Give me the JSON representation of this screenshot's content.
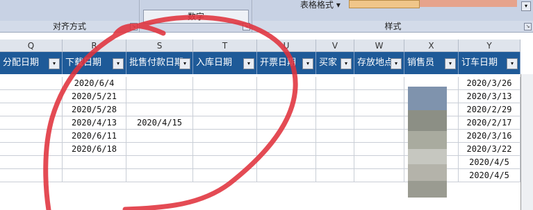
{
  "ribbon": {
    "align_label": "对齐方式",
    "number_label": "数字",
    "number_format": "数字",
    "style_label": "样式",
    "table_format_label": "表格格式 ▾",
    "launcher_glyph": "↘",
    "scroll_glyph": "▾"
  },
  "columns": [
    "Q",
    "R",
    "S",
    "T",
    "U",
    "V",
    "W",
    "X",
    "Y"
  ],
  "headers": [
    "分配日期",
    "下载日期",
    "批售付款日期",
    "入库日期",
    "开票日期",
    "买家",
    "存放地点",
    "销售员",
    "订车日期"
  ],
  "filter_glyphs": [
    "▾",
    "▾",
    "▾",
    "▾",
    "▾",
    "▾",
    "▾",
    "▾",
    "▾"
  ],
  "rows": [
    {
      "R": "2020/6/4",
      "S": "",
      "Y": "2020/3/26"
    },
    {
      "R": "2020/5/21",
      "S": "",
      "Y": "2020/3/13"
    },
    {
      "R": "2020/5/28",
      "S": "",
      "Y": "2020/2/29"
    },
    {
      "R": "2020/4/13",
      "S": "2020/4/15",
      "Y": "2020/2/17"
    },
    {
      "R": "2020/6/11",
      "S": "",
      "Y": "2020/3/16"
    },
    {
      "R": "2020/6/18",
      "S": "",
      "Y": "2020/3/22"
    },
    {
      "R": "",
      "S": "",
      "Y": "2020/4/5"
    },
    {
      "R": "",
      "S": "",
      "Y": "2020/4/5"
    }
  ],
  "colors": {
    "header_bg": "#1e5a98",
    "ink": "#e0323c"
  }
}
